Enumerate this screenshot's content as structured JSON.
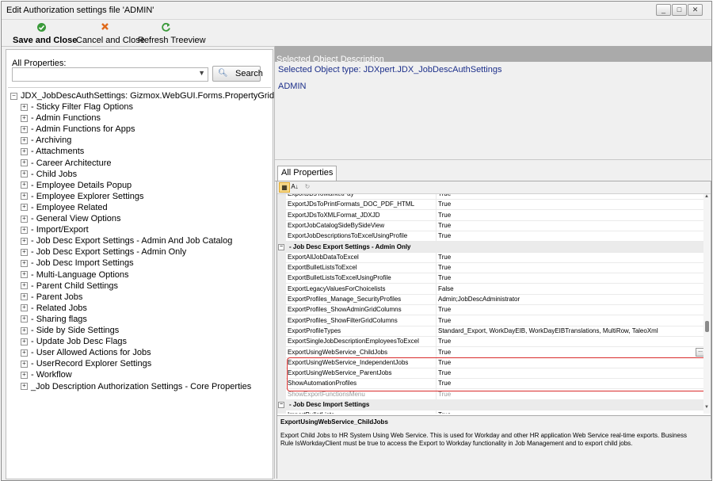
{
  "window": {
    "title": "Edit Authorization settings file 'ADMIN'",
    "controls": {
      "minimize": "_",
      "maximize": "□",
      "close": "✕"
    }
  },
  "toolbar": {
    "save_close": "Save and Close",
    "cancel_close": "Cancel and Close",
    "refresh": "Refresh Treeview",
    "colors": {
      "save_icon": "#3a9a3a",
      "cancel_icon": "#e06a1b",
      "refresh_icon": "#3a9a3a"
    }
  },
  "left": {
    "all_properties_label": "All Properties:",
    "combo_value": "",
    "search_label": "Search",
    "tree_root": "JDX_JobDescAuthSettings: Gizmox.WebGUI.Forms.PropertyGrid",
    "tree_items": [
      "- Sticky Filter Flag Options",
      "- Admin Functions",
      "- Admin Functions for Apps",
      "- Archiving",
      "- Attachments",
      "- Career Architecture",
      "- Child Jobs",
      "- Employee Details Popup",
      "- Employee Explorer Settings",
      "- Employee Related",
      "- General View Options",
      "- Import/Export",
      "- Job Desc Export Settings - Admin And Job Catalog",
      "- Job Desc Export Settings - Admin Only",
      "- Job Desc Import Settings",
      "- Multi-Language Options",
      "- Parent Child Settings",
      "- Parent Jobs",
      "- Related Jobs",
      "- Sharing flags",
      "- Side by Side Settings",
      "- Update Job Desc Flags",
      "- User Allowed Actions for Jobs",
      "- UserRecord Explorer Settings",
      "- Workflow",
      "_Job Description Authorization Settings - Core Properties"
    ]
  },
  "right": {
    "desc_header": "Selected Object Description",
    "selected_type": "Selected Object type: JDXpert.JDX_JobDescAuthSettings",
    "selected_name": "ADMIN",
    "tab_label": "All Properties",
    "rows": [
      {
        "name": "ExportJDsToMarketPay",
        "value": "True",
        "kind": "prop"
      },
      {
        "name": "ExportJDsToPrintFormats_DOC_PDF_HTML",
        "value": "True",
        "kind": "prop"
      },
      {
        "name": "ExportJDsToXMLFormat_JDXJD",
        "value": "True",
        "kind": "prop"
      },
      {
        "name": "ExportJobCatalogSideBySideView",
        "value": "True",
        "kind": "prop"
      },
      {
        "name": "ExportJobDescriptionsToExcelUsingProfile",
        "value": "True",
        "kind": "prop"
      },
      {
        "name": "- Job Desc Export Settings - Admin Only",
        "value": "",
        "kind": "cat"
      },
      {
        "name": "ExportAllJobDataToExcel",
        "value": "True",
        "kind": "prop"
      },
      {
        "name": "ExportBulletListsToExcel",
        "value": "True",
        "kind": "prop"
      },
      {
        "name": "ExportBulletListsToExcelUsingProfile",
        "value": "True",
        "kind": "prop"
      },
      {
        "name": "ExportLegacyValuesForChoicelists",
        "value": "False",
        "kind": "prop"
      },
      {
        "name": "ExportProfiles_Manage_SecurityProfiles",
        "value": "Admin;JobDescAdministrator",
        "kind": "prop"
      },
      {
        "name": "ExportProfiles_ShowAdminGridColumns",
        "value": "True",
        "kind": "prop"
      },
      {
        "name": "ExportProfiles_ShowFilterGridColumns",
        "value": "True",
        "kind": "prop"
      },
      {
        "name": "ExportProfileTypes",
        "value": "Standard_Export, WorkDayEIB, WorkDayEIBTranslations, MultiRow, TaleoXml",
        "kind": "prop"
      },
      {
        "name": "ExportSingleJobDescriptionEmployeesToExcel",
        "value": "True",
        "kind": "prop"
      },
      {
        "name": "ExportUsingWebService_ChildJobs",
        "value": "True",
        "kind": "prop"
      },
      {
        "name": "ExportUsingWebService_IndependentJobs",
        "value": "True",
        "kind": "prop"
      },
      {
        "name": "ExportUsingWebService_ParentJobs",
        "value": "True",
        "kind": "prop"
      },
      {
        "name": "ShowAutomationProfiles",
        "value": "True",
        "kind": "prop"
      },
      {
        "name": "ShowExportFunctionsMenu",
        "value": "True",
        "kind": "dim"
      },
      {
        "name": "- Job Desc Import Settings",
        "value": "",
        "kind": "cat"
      },
      {
        "name": "ImportBulletLists",
        "value": "True",
        "kind": "prop"
      }
    ],
    "help_title": "ExportUsingWebService_ChildJobs",
    "help_text": "Export Child Jobs to HR System Using Web Service. This is used for Workday and other HR application Web Service real-time exports. Business Rule IsWorkdayClient must be true to access the Export to Workday functionality in Job Management and to export child jobs.",
    "highlight_color": "#d92c2c"
  }
}
